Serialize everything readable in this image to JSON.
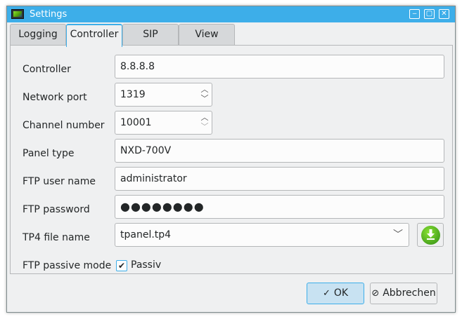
{
  "window": {
    "title": "Settings"
  },
  "tabs": [
    {
      "label": "Logging"
    },
    {
      "label": "Controller"
    },
    {
      "label": "SIP"
    },
    {
      "label": "View"
    }
  ],
  "active_tab": "Controller",
  "form": {
    "controller": {
      "label": "Controller",
      "value": "8.8.8.8"
    },
    "network_port": {
      "label": "Network port",
      "value": "1319"
    },
    "channel_number": {
      "label": "Channel number",
      "value": "10001"
    },
    "panel_type": {
      "label": "Panel type",
      "value": "NXD-700V"
    },
    "ftp_user": {
      "label": "FTP user name",
      "value": "administrator"
    },
    "ftp_password": {
      "label": "FTP password",
      "value": "●●●●●●●●"
    },
    "tp4_file": {
      "label": "TP4 file name",
      "value": "tpanel.tp4"
    },
    "ftp_passive": {
      "label": "FTP passive mode",
      "checkbox_label": "Passiv",
      "checked": true
    }
  },
  "buttons": {
    "ok": "OK",
    "cancel": "Abbrechen"
  },
  "icons": {
    "app": "app-icon",
    "minimize": "minimize-icon",
    "maximize": "maximize-icon",
    "close": "close-icon",
    "spin": "spin-arrows-icon",
    "dropdown": "chevron-down-icon",
    "download": "download-icon",
    "checkmark": "checkmark-icon",
    "cancel": "cancel-icon"
  },
  "colors": {
    "accent": "#3daee9",
    "download_green": "#4e9a06"
  }
}
